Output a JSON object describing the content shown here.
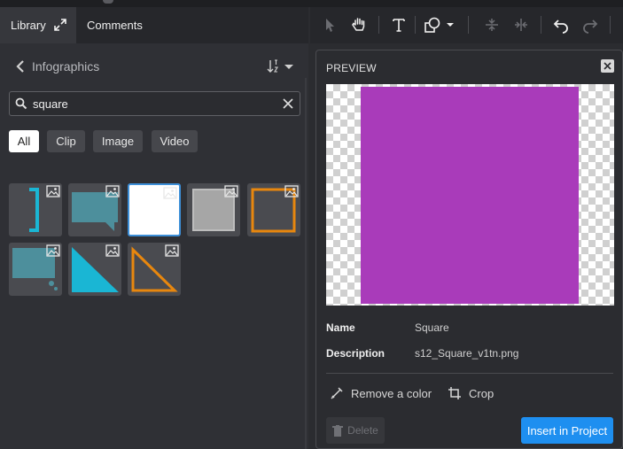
{
  "tabs": {
    "library": "Library",
    "comments": "Comments"
  },
  "header": {
    "title": "Infographics"
  },
  "search": {
    "value": "square"
  },
  "filters": [
    "All",
    "Clip",
    "Image",
    "Video"
  ],
  "results": [
    {
      "name": "bracket"
    },
    {
      "name": "speech-bubble"
    },
    {
      "name": "square",
      "selected": true
    },
    {
      "name": "gray-square"
    },
    {
      "name": "orange-outline-square"
    },
    {
      "name": "callout-box"
    },
    {
      "name": "teal-triangle"
    },
    {
      "name": "orange-outline-triangle"
    }
  ],
  "preview": {
    "title": "PREVIEW",
    "fill_color": "#a93bba",
    "name_label": "Name",
    "name_value": "Square",
    "description_label": "Description",
    "description_value": "s12_Square_v1tn.png",
    "remove_color": "Remove a color",
    "crop": "Crop",
    "delete": "Delete",
    "insert": "Insert in Project"
  },
  "colors": {
    "accent": "#1e8ff0",
    "teal": "#1ab6d4",
    "orange": "#e8870e"
  }
}
